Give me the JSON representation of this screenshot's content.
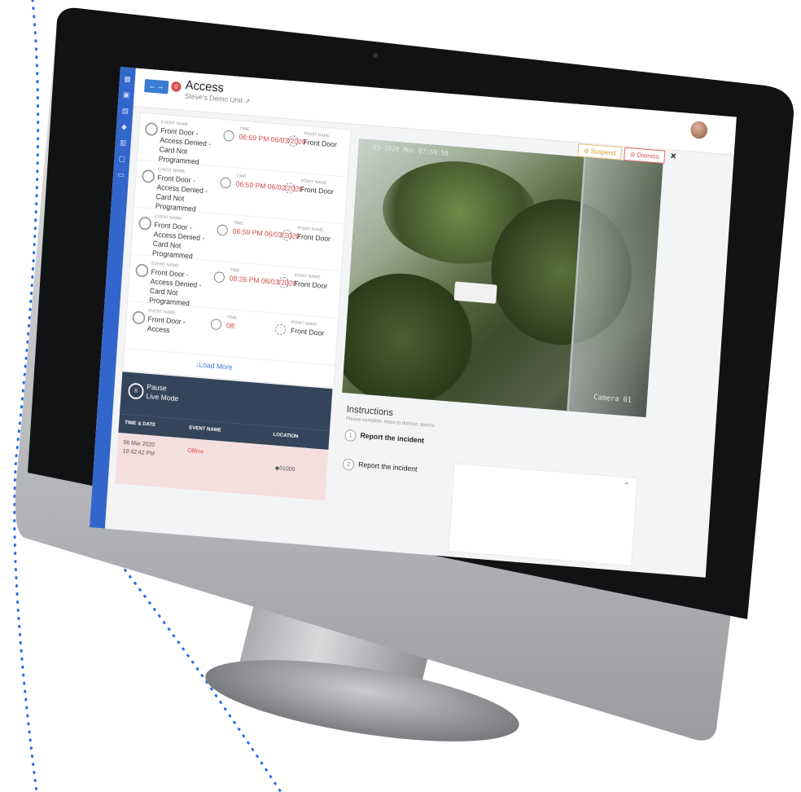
{
  "header": {
    "title": "Access",
    "subtitle": "Steve's Demo Unit",
    "nav_glyph": "←→",
    "alarm_glyph": "0"
  },
  "sidebar": {
    "icons": [
      "dashboard-icon",
      "contacts-icon",
      "list-icon",
      "bell-icon",
      "report-icon",
      "calendar-icon",
      "monitor-icon"
    ]
  },
  "events": [
    {
      "label": "EVENT NAME",
      "name": "Front Door - Access Denied - Card Not Programmed",
      "time_label": "TIME",
      "time": "06:59 PM 06/03/2020",
      "point_label": "POINT NAME",
      "point": "Front Door"
    },
    {
      "label": "EVENT NAME",
      "name": "Front Door - Access Denied - Card Not Programmed",
      "time_label": "TIME",
      "time": "06:59 PM 06/03/2020",
      "point_label": "POINT NAME",
      "point": "Front Door"
    },
    {
      "label": "EVENT NAME",
      "name": "Front Door - Access Denied - Card Not Programmed",
      "time_label": "TIME",
      "time": "06:59 PM 06/03/2020",
      "point_label": "POINT NAME",
      "point": "Front Door"
    },
    {
      "label": "EVENT NAME",
      "name": "Front Door - Access Denied - Card Not Programmed",
      "time_label": "TIME",
      "time": "08:26 PM 06/03/2020",
      "point_label": "POINT NAME",
      "point": "Front Door"
    },
    {
      "label": "EVENT NAME",
      "name": "Front Door - Access",
      "time_label": "TIME",
      "time": "08:",
      "point_label": "POINT NAME",
      "point": "Front Door"
    }
  ],
  "load_more": "Load More",
  "live": {
    "line1": "Pause",
    "line2": "Live Mode"
  },
  "table": {
    "col_time": "TIME & DATE",
    "col_event": "EVENT NAME",
    "col_location": "LOCATION",
    "row": {
      "date": "06 Mar 2020",
      "time": "10:42:42 PM",
      "event": "Offline",
      "location": "01000"
    }
  },
  "actions": {
    "suspend": "Suspend",
    "dismiss": "Dismiss",
    "close": "×"
  },
  "video": {
    "timestamp": "03-2020 Mon 07:59:58",
    "camera": "Camera 01"
  },
  "instructions": {
    "title": "Instructions",
    "subtitle": "Please complete steps to dismiss alarms",
    "steps": [
      {
        "num": "1",
        "text": "Report the incident"
      },
      {
        "num": "2",
        "text": "Report the incident"
      }
    ]
  },
  "colors": {
    "accent": "#3a7bd5",
    "sidebar": "#3366cc",
    "alarm": "#d94b4b",
    "suspend": "#d49a2a",
    "live_bar": "#34445a"
  }
}
